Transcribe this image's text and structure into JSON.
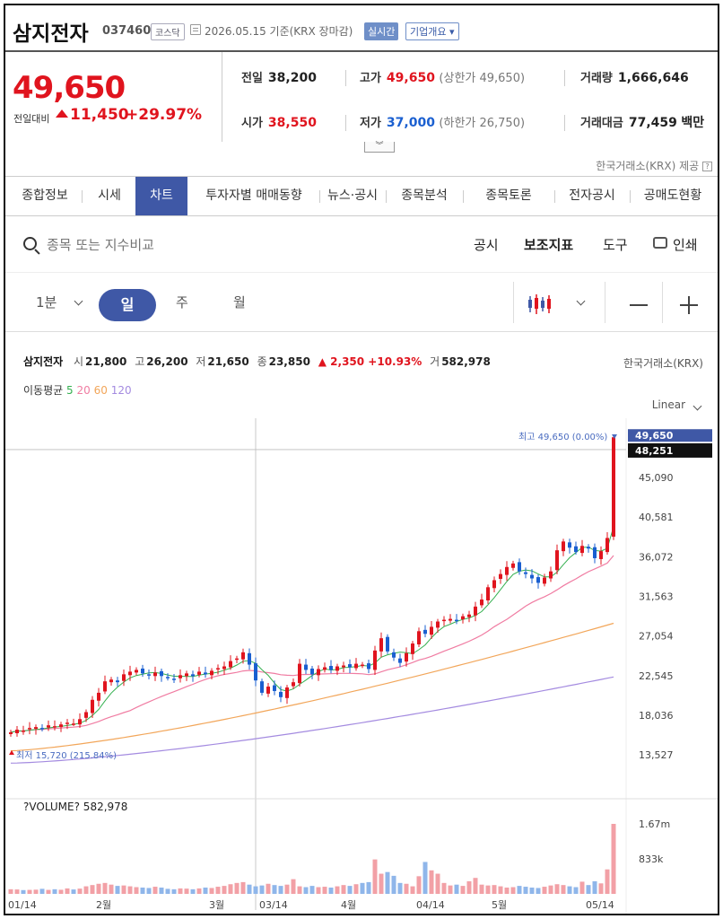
{
  "header": {
    "name": "삼지전자",
    "code": "037460",
    "market": "코스닥",
    "date": "2026.05.15",
    "date_note": "기준(KRX 장마감)",
    "realtime": "실시간",
    "corp_info": "기업개요"
  },
  "price": {
    "current": "49,650",
    "change_label": "전일대비",
    "change": "11,450",
    "change_pct": "+29.97%"
  },
  "stats": {
    "prev_label": "전일",
    "prev": "38,200",
    "high_label": "고가",
    "high": "49,650",
    "upper_limit": "(상한가 49,650)",
    "volume_label": "거래량",
    "volume": "1,666,646",
    "open_label": "시가",
    "open": "38,550",
    "low_label": "저가",
    "low": "37,000",
    "lower_limit": "(하한가 26,750)",
    "amount_label": "거래대금",
    "amount": "77,459",
    "amount_unit": "백만"
  },
  "provider": "한국거래소(KRX) 제공",
  "tabs": [
    "종합정보",
    "시세",
    "차트",
    "투자자별 매매동향",
    "뉴스·공시",
    "종목분석",
    "종목토론",
    "전자공시",
    "공매도현황"
  ],
  "toolbar": {
    "search_placeholder": "종목 또는 지수비교",
    "disclosure": "공시",
    "indicators": "보조지표",
    "tools": "도구",
    "print": "인쇄"
  },
  "periods": {
    "minute": "1분",
    "day": "일",
    "week": "주",
    "month": "월"
  },
  "chart_info": {
    "name": "삼지전자",
    "open_label": "시",
    "open": "21,800",
    "high_label": "고",
    "high": "26,200",
    "low_label": "저",
    "low": "21,650",
    "close_label": "종",
    "close": "23,850",
    "change": "▲ 2,350 +10.93%",
    "vol_label": "거",
    "vol": "582,978",
    "source": "한국거래소(KRX)",
    "ma_label": "이동평균",
    "ma_5": "5",
    "ma_20": "20",
    "ma_60": "60",
    "ma_120": "120",
    "scale": "Linear",
    "max_label": "최고 49,650 (0.00%)",
    "min_label": "최저 15,720 (215.84%)",
    "volume_header": "?VOLUME? 582,978"
  },
  "colors": {
    "up": "#e0141e",
    "down": "#1a5fd0",
    "accent": "#3f58a6",
    "ma5": "#35b050",
    "ma20": "#f07ca2",
    "ma60": "#f2a65a",
    "ma120": "#a48be0"
  },
  "chart_data": {
    "type": "candlestick",
    "y_ticks": [
      "49,650",
      "48,251",
      "45,090",
      "40,581",
      "36,072",
      "31,563",
      "27,054",
      "22,545",
      "18,036",
      "13,527"
    ],
    "ylim": [
      11000,
      51000
    ],
    "x_ticks": [
      "01/14",
      "2월",
      "3월",
      "03/14",
      "4월",
      "04/14",
      "5월",
      "05/14"
    ],
    "volume_ticks": [
      "1.67m",
      "833k"
    ],
    "closes": [
      16100,
      16400,
      16300,
      16600,
      16700,
      16500,
      16900,
      16800,
      17000,
      17200,
      17100,
      17600,
      18400,
      19800,
      20600,
      21900,
      22100,
      21800,
      22700,
      23000,
      23200,
      22800,
      22600,
      22900,
      22500,
      22300,
      22100,
      22600,
      22800,
      22500,
      23000,
      22700,
      23100,
      23400,
      23600,
      24200,
      24500,
      25200,
      23800,
      22000,
      20600,
      21300,
      20800,
      20100,
      21200,
      21800,
      23900,
      23200,
      22700,
      23300,
      23500,
      23200,
      23600,
      23700,
      23500,
      23900,
      23800,
      23300,
      25400,
      26800,
      25300,
      24600,
      24000,
      25100,
      26200,
      27600,
      27300,
      28100,
      28700,
      28900,
      29000,
      28800,
      29300,
      29500,
      30400,
      31200,
      32600,
      33400,
      34100,
      34900,
      35300,
      34400,
      34100,
      33600,
      33100,
      33700,
      34400,
      36800,
      37800,
      37100,
      36600,
      37300,
      37000,
      35900,
      36700,
      38200,
      49650
    ],
    "volumes": [
      110000,
      105000,
      90000,
      95000,
      100000,
      120000,
      95000,
      110000,
      98000,
      130000,
      105000,
      125000,
      180000,
      210000,
      240000,
      260000,
      220000,
      190000,
      200000,
      180000,
      160000,
      150000,
      140000,
      170000,
      150000,
      120000,
      110000,
      130000,
      125000,
      110000,
      130000,
      150000,
      140000,
      170000,
      190000,
      230000,
      260000,
      280000,
      220000,
      180000,
      200000,
      240000,
      210000,
      190000,
      220000,
      350000,
      180000,
      160000,
      190000,
      160000,
      170000,
      150000,
      180000,
      210000,
      190000,
      230000,
      260000,
      280000,
      820000,
      480000,
      520000,
      430000,
      260000,
      240000,
      180000,
      420000,
      760000,
      560000,
      480000,
      260000,
      200000,
      220000,
      190000,
      300000,
      380000,
      220000,
      200000,
      210000,
      180000,
      150000,
      160000,
      190000,
      170000,
      150000,
      140000,
      170000,
      200000,
      230000,
      210000,
      180000,
      160000,
      290000,
      210000,
      300000,
      250000,
      582978,
      1666646
    ]
  }
}
